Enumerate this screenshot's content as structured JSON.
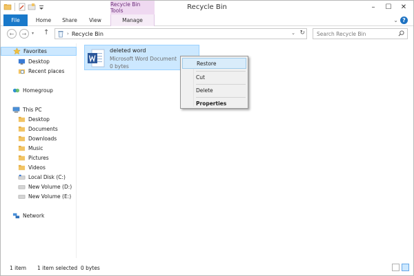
{
  "window": {
    "title": "Recycle Bin",
    "context_tools_label": "Recycle Bin Tools",
    "buttons": {
      "minimize": "–",
      "maximize": "☐",
      "close": "✕"
    }
  },
  "ribbon": {
    "tabs": [
      {
        "label": "File"
      },
      {
        "label": "Home"
      },
      {
        "label": "Share"
      },
      {
        "label": "View"
      },
      {
        "label": "Manage"
      }
    ],
    "toggle_glyph": "⌄",
    "help_glyph": "?"
  },
  "address": {
    "back_glyph": "←",
    "forward_glyph": "→",
    "recent_glyph": "▾",
    "up_glyph": "↑",
    "path": "Recycle Bin",
    "chevron": "›",
    "drop_glyph": "⌄",
    "refresh_glyph": "↻",
    "search_placeholder": "Search Recycle Bin"
  },
  "nav": {
    "items": [
      {
        "label": "Favorites",
        "icon": "star-icon"
      },
      {
        "label": "Desktop",
        "icon": "desktop-icon"
      },
      {
        "label": "Recent places",
        "icon": "recent-places-icon"
      },
      {
        "label": "Homegroup",
        "icon": "homegroup-icon"
      },
      {
        "label": "This PC",
        "icon": "computer-icon"
      },
      {
        "label": "Desktop",
        "icon": "folder-icon"
      },
      {
        "label": "Documents",
        "icon": "folder-icon"
      },
      {
        "label": "Downloads",
        "icon": "folder-icon"
      },
      {
        "label": "Music",
        "icon": "folder-icon"
      },
      {
        "label": "Pictures",
        "icon": "folder-icon"
      },
      {
        "label": "Videos",
        "icon": "folder-icon"
      },
      {
        "label": "Local Disk (C:)",
        "icon": "drive-icon"
      },
      {
        "label": "New Volume (D:)",
        "icon": "drive-icon"
      },
      {
        "label": "New Volume (E:)",
        "icon": "drive-icon"
      },
      {
        "label": "Network",
        "icon": "network-icon"
      }
    ]
  },
  "file": {
    "name": "deleted word",
    "type": "Microsoft Word Document",
    "size": "0 bytes",
    "icon": "word-document-icon"
  },
  "context_menu": {
    "items": [
      {
        "label": "Restore"
      },
      {
        "label": "Cut"
      },
      {
        "label": "Delete"
      },
      {
        "label": "Properties"
      }
    ]
  },
  "status": {
    "count": "1 item",
    "selection": "1 item selected  0 bytes"
  },
  "colors": {
    "file_tab": "#1979ca",
    "context_tab": "#efd9f1",
    "selection": "#cce8ff"
  }
}
